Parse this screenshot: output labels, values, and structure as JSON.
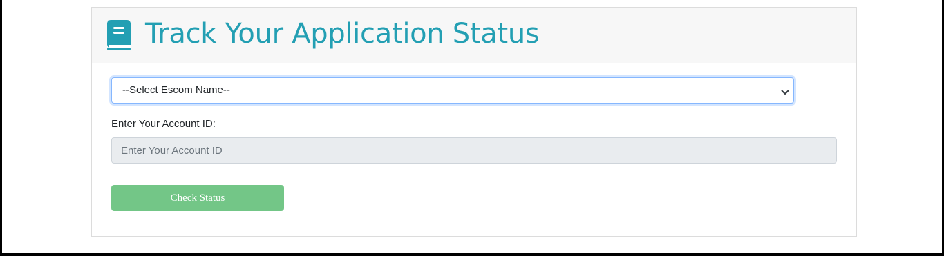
{
  "header": {
    "title": "Track Your Application Status",
    "icon": "book-icon"
  },
  "form": {
    "escom_select": {
      "selected": "--Select Escom Name--",
      "icon": "chevron-down-icon"
    },
    "account_id": {
      "label": "Enter Your Account ID:",
      "value": "",
      "placeholder": "Enter Your Account ID"
    },
    "submit_label": "Check Status"
  },
  "colors": {
    "title": "#239fb3",
    "header_background": "#f7f7f7",
    "input_disabled_background": "#e9ecef",
    "select_focus_border": "#86b7fe",
    "button_background": "#73c687",
    "outer_border": "#000000"
  }
}
